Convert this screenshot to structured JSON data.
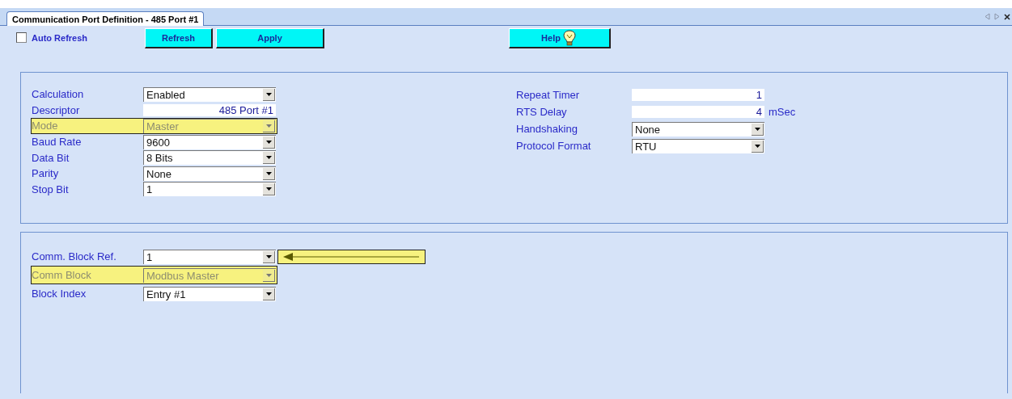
{
  "tab": {
    "label": "Communication Port Definition - 485 Port #1",
    "selected": true
  },
  "toolbar": {
    "auto_refresh": {
      "label": "Auto Refresh",
      "checked": false
    },
    "buttons": [
      {
        "label": "Refresh",
        "kind": "plain"
      },
      {
        "label": "Apply",
        "kind": "plain"
      },
      {
        "label": "Help",
        "kind": "help"
      }
    ]
  },
  "port_panel": {
    "left": [
      {
        "label": "Calculation",
        "kind": "select",
        "value": "Enabled",
        "disabled": false,
        "highlighted": false
      },
      {
        "label": "Descriptor",
        "kind": "text",
        "value": "485 Port #1",
        "disabled": false,
        "highlighted": false
      },
      {
        "label": "Mode",
        "kind": "select",
        "value": "Master",
        "disabled": true,
        "highlighted": true
      },
      {
        "label": "Baud Rate",
        "kind": "select",
        "value": "9600",
        "disabled": false,
        "highlighted": false
      },
      {
        "label": "Data Bit",
        "kind": "select",
        "value": "8 Bits",
        "disabled": false,
        "highlighted": false
      },
      {
        "label": "Parity",
        "kind": "select",
        "value": "None",
        "disabled": false,
        "highlighted": false
      },
      {
        "label": "Stop Bit",
        "kind": "select",
        "value": "1",
        "disabled": false,
        "highlighted": false
      }
    ],
    "right": [
      {
        "label": "Repeat Timer",
        "kind": "text",
        "value": "1",
        "disabled": false,
        "highlighted": false
      },
      {
        "label": "RTS Delay",
        "kind": "text",
        "value": "4",
        "unit": "mSec",
        "disabled": false,
        "highlighted": false
      },
      {
        "label": "Handshaking",
        "kind": "select",
        "value": "None",
        "disabled": false,
        "highlighted": false
      },
      {
        "label": "Protocol Format",
        "kind": "select",
        "value": "RTU",
        "disabled": false,
        "highlighted": false
      }
    ]
  },
  "block_panel": {
    "fields": [
      {
        "label": "Comm. Block Ref.",
        "kind": "select",
        "value": "1",
        "disabled": false,
        "highlighted": false,
        "arrow": true
      },
      {
        "label": "Comm Block",
        "kind": "select",
        "value": "Modbus Master",
        "disabled": true,
        "highlighted": true
      },
      {
        "label": "Block Index",
        "kind": "select",
        "value": "Entry #1",
        "disabled": false,
        "highlighted": false
      }
    ]
  }
}
